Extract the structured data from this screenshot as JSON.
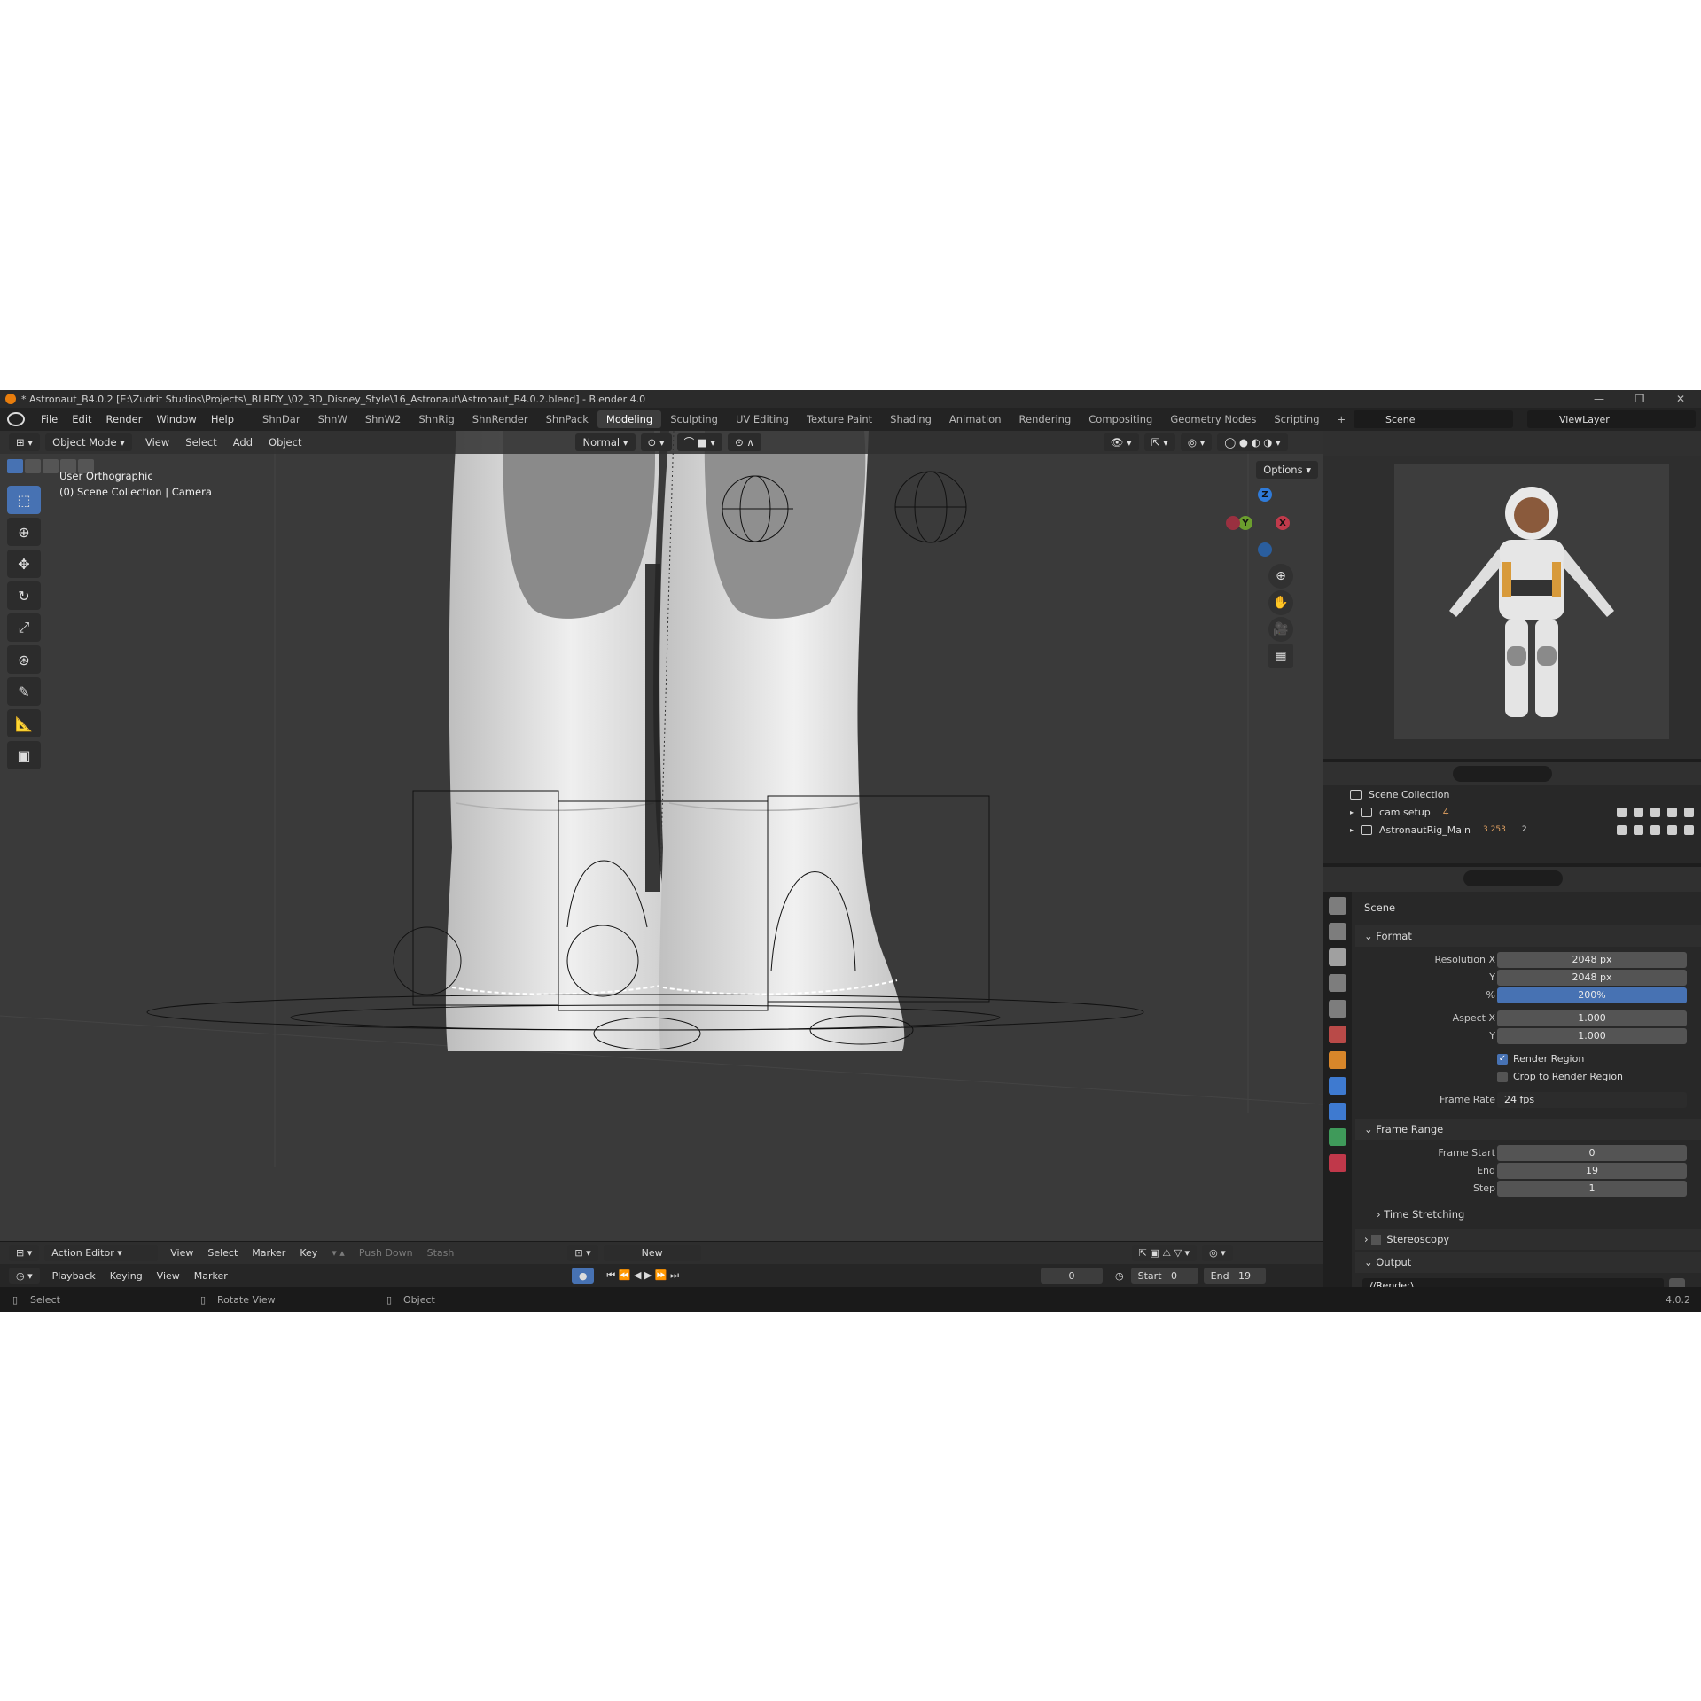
{
  "window": {
    "title": "* Astronaut_B4.0.2 [E:\\Zudrit Studios\\Projects\\_BLRDY_\\02_3D_Disney_Style\\16_Astronaut\\Astronaut_B4.0.2.blend] - Blender 4.0",
    "min": "—",
    "max": "❐",
    "close": "✕"
  },
  "menu": [
    "File",
    "Edit",
    "Render",
    "Window",
    "Help"
  ],
  "workspaces": [
    "ShnDar",
    "ShnW",
    "ShnW2",
    "ShnRig",
    "ShnRender",
    "ShnPack",
    "Modeling",
    "Sculpting",
    "UV Editing",
    "Texture Paint",
    "Shading",
    "Animation",
    "Rendering",
    "Compositing",
    "Geometry Nodes",
    "Scripting",
    "+"
  ],
  "active_workspace": "Modeling",
  "scene_name": "Scene",
  "view_layer": "ViewLayer",
  "viewport": {
    "mode": "Object Mode",
    "menus": [
      "View",
      "Select",
      "Add",
      "Object"
    ],
    "orientation": "Normal",
    "overlay_line1": "User Orthographic",
    "overlay_line2": "(0) Scene Collection | Camera",
    "options": "Options",
    "gizmo": {
      "z": "Z",
      "y": "Y",
      "x": "X"
    }
  },
  "outliner": {
    "root": "Scene Collection",
    "items": [
      {
        "name": "cam setup",
        "badge": "4"
      },
      {
        "name": "AstronautRig_Main",
        "badge": "3 253",
        "badge2": "2"
      }
    ]
  },
  "properties": {
    "context": "Scene",
    "format": {
      "title": "Format",
      "res_x_label": "Resolution X",
      "res_x": "2048 px",
      "res_y_label": "Y",
      "res_y": "2048 px",
      "pct_label": "%",
      "pct": "200%",
      "aspect_x_label": "Aspect X",
      "aspect_x": "1.000",
      "aspect_y_label": "Y",
      "aspect_y": "1.000",
      "render_region": "Render Region",
      "crop": "Crop to Render Region",
      "fps_label": "Frame Rate",
      "fps": "24 fps"
    },
    "frame_range": {
      "title": "Frame Range",
      "start_label": "Frame Start",
      "start": "0",
      "end_label": "End",
      "end": "19",
      "step_label": "Step",
      "step": "1",
      "time_stretching": "Time Stretching"
    },
    "stereoscopy": "Stereoscopy",
    "output": {
      "title": "Output",
      "path": "//Render\\"
    }
  },
  "dopesheet": {
    "mode": "Action Editor",
    "menus": [
      "View",
      "Select",
      "Marker",
      "Key"
    ],
    "push_down": "Push Down",
    "stash": "Stash",
    "new": "New"
  },
  "timeline": {
    "menus": [
      "Playback",
      "Keying",
      "View",
      "Marker"
    ],
    "current": "0",
    "start_label": "Start",
    "start": "0",
    "end_label": "End",
    "end": "19"
  },
  "status": {
    "select": "Select",
    "rotate": "Rotate View",
    "object": "Object",
    "version": "4.0.2"
  },
  "colors": {
    "accent": "#4772b3",
    "active_tab": "#3d3d3d",
    "viewport_bg": "#3a3a3a"
  }
}
